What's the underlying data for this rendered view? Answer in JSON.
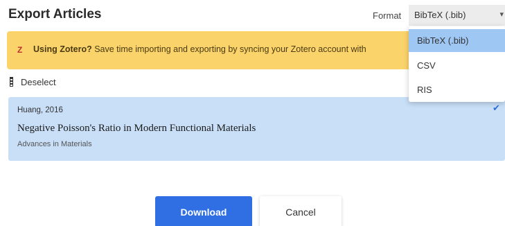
{
  "dialog": {
    "title": "Export Articles"
  },
  "format": {
    "label": "Format",
    "selected": "BibTeX (.bib)",
    "options": [
      "BibTeX (.bib)",
      "CSV",
      "RIS"
    ]
  },
  "zotero_banner": {
    "logo": "Z",
    "bold_text": "Using Zotero?",
    "text": " Save time importing and exporting by syncing your Zotero account with"
  },
  "selection": {
    "deselect_label": "Deselect"
  },
  "articles": [
    {
      "meta": "Huang, 2016",
      "title": "Negative Poisson's Ratio in Modern Functional Materials",
      "journal": "Advances in Materials",
      "selected": true
    }
  ],
  "actions": {
    "download_label": "Download",
    "cancel_label": "Cancel"
  },
  "colors": {
    "accent": "#2f6fe3",
    "banner": "#fbd36b",
    "selected_row": "#c8dff7",
    "dropdown_selected": "#9fc7f3"
  }
}
